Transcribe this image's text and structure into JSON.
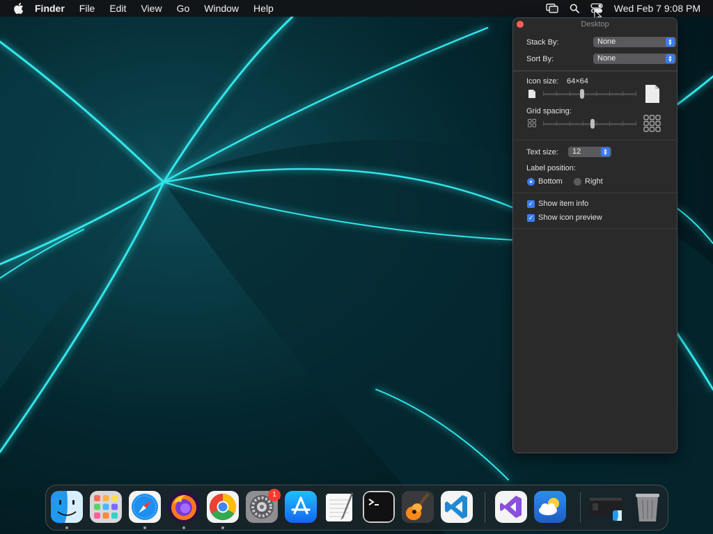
{
  "menubar": {
    "app_name": "Finder",
    "menus": [
      "File",
      "Edit",
      "View",
      "Go",
      "Window",
      "Help"
    ],
    "clock": "Wed Feb 7  9:08 PM",
    "icons": [
      "apple-icon",
      "screen-mirroring-icon",
      "spotlight-search-icon",
      "control-center-icon"
    ]
  },
  "panel": {
    "title": "Desktop",
    "stack_by_label": "Stack By:",
    "stack_by_value": "None",
    "sort_by_label": "Sort By:",
    "sort_by_value": "None",
    "icon_size_label": "Icon size:",
    "icon_size_value": "64×64",
    "icon_size_slider_fraction": 0.42,
    "grid_spacing_label": "Grid spacing:",
    "grid_spacing_slider_fraction": 0.53,
    "text_size_label": "Text size:",
    "text_size_value": "12",
    "label_position_label": "Label position:",
    "label_position_options": [
      "Bottom",
      "Right"
    ],
    "label_position_selected": "Bottom",
    "show_item_info_label": "Show item info",
    "show_item_info_checked": true,
    "show_icon_preview_label": "Show icon preview",
    "show_icon_preview_checked": true
  },
  "dock": {
    "apps": [
      {
        "name": "finder",
        "running": true
      },
      {
        "name": "launchpad",
        "running": false
      },
      {
        "name": "safari",
        "running": true
      },
      {
        "name": "firefox",
        "running": true
      },
      {
        "name": "chrome",
        "running": true
      },
      {
        "name": "system-settings",
        "running": false,
        "badge": "1"
      },
      {
        "name": "app-store",
        "running": false
      },
      {
        "name": "textedit",
        "running": false
      },
      {
        "name": "terminal",
        "running": false
      },
      {
        "name": "garageband",
        "running": false
      },
      {
        "name": "vscode",
        "running": false
      },
      {
        "name": "visual-studio",
        "running": false
      },
      {
        "name": "weather",
        "running": false
      },
      {
        "name": "finder-window-minimized",
        "running": false
      },
      {
        "name": "trash",
        "running": false
      }
    ]
  },
  "colors": {
    "accent": "#3a7cf5",
    "wallpaper_glow": "#29e0e6",
    "close_button": "#ff5f57",
    "badge": "#ff3b30"
  }
}
